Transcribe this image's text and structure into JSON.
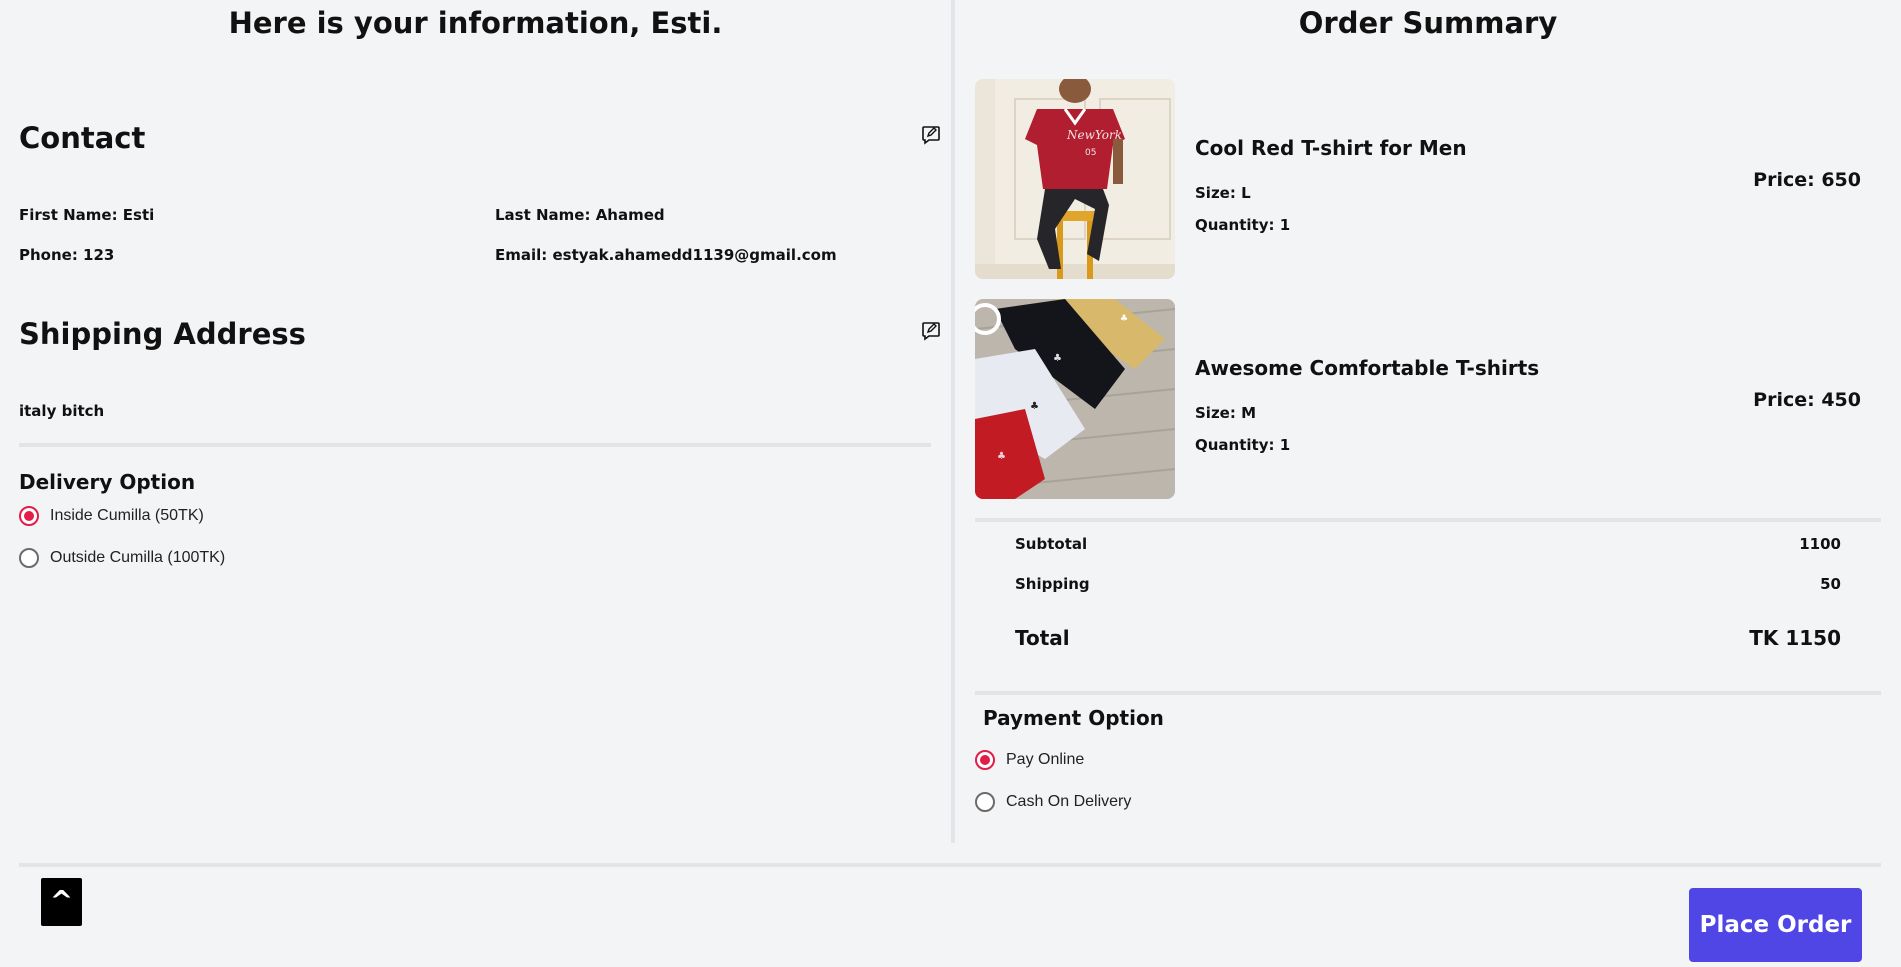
{
  "info": {
    "title": "Here is your information, Esti.",
    "contact": {
      "heading": "Contact",
      "first_name": "First Name: Esti",
      "last_name": "Last Name: Ahamed",
      "phone": "Phone: 123",
      "email": "Email: estyak.ahamedd1139@gmail.com"
    },
    "shipping": {
      "heading": "Shipping Address",
      "address": "italy bitch"
    },
    "delivery": {
      "heading": "Delivery Option",
      "options": [
        {
          "label": "Inside Cumilla (50TK)",
          "selected": true
        },
        {
          "label": "Outside Cumilla (100TK)",
          "selected": false
        }
      ]
    }
  },
  "order": {
    "title": "Order Summary",
    "items": [
      {
        "name": "Cool Red T-shirt for Men",
        "size": "Size: L",
        "quantity": "Quantity: 1",
        "price": "Price: 650",
        "image": "man-in-red-tshirt-photo"
      },
      {
        "name": "Awesome Comfortable T-shirts",
        "size": "Size: M",
        "quantity": "Quantity: 1",
        "price": "Price: 450",
        "image": "folded-tshirts-photo"
      }
    ],
    "summary": {
      "subtotal_label": "Subtotal",
      "subtotal": "1100",
      "shipping_label": "Shipping",
      "shipping": "50",
      "total_label": "Total",
      "total": "TK 1150"
    },
    "payment": {
      "heading": "Payment Option",
      "options": [
        {
          "label": "Pay Online",
          "selected": true
        },
        {
          "label": "Cash On Delivery",
          "selected": false
        }
      ]
    }
  },
  "footer": {
    "scroll_top_label": "^",
    "place_order_label": "Place Order"
  },
  "colors": {
    "accent": "#4f46e5",
    "radio_selected": "#e11d48",
    "background": "#f3f4f6"
  }
}
